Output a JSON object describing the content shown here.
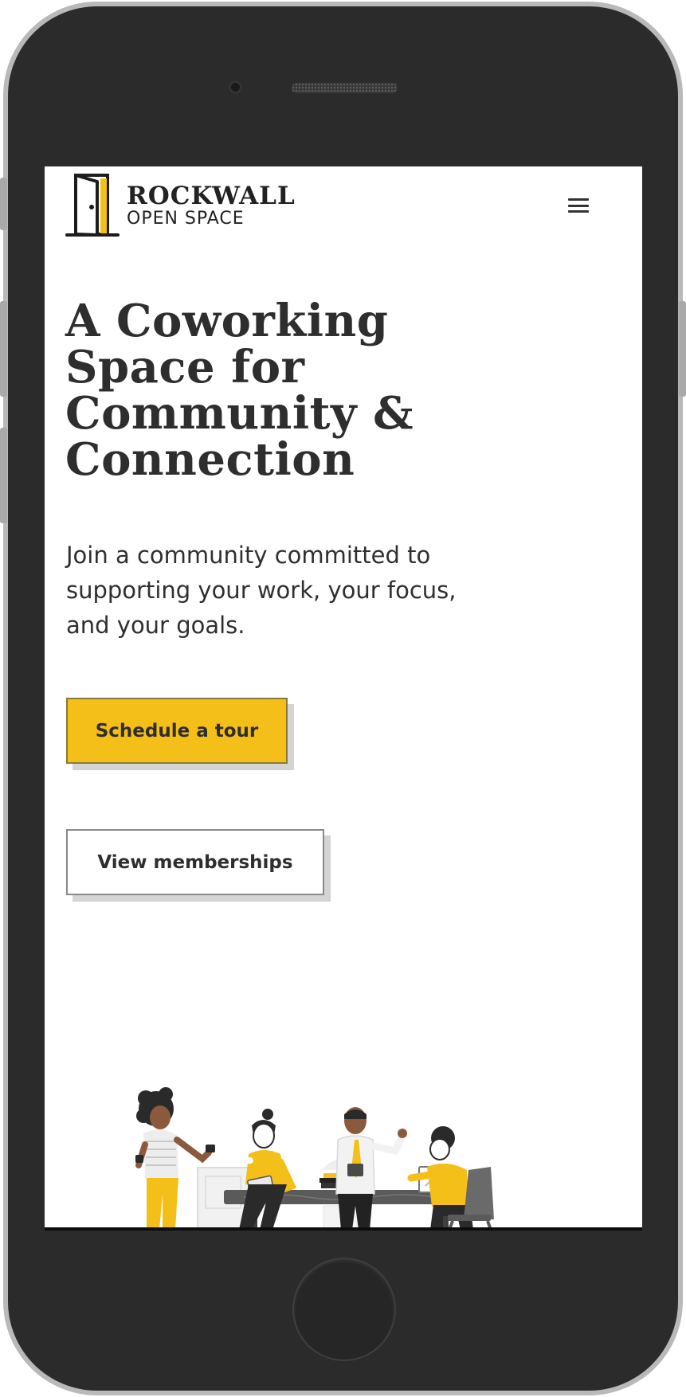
{
  "brand": {
    "name": "ROCKWALL",
    "tagline": "OPEN SPACE"
  },
  "hero": {
    "headline_lines": [
      "A Coworking",
      "Space for",
      "Community &",
      "Connection"
    ],
    "subtext_lines": [
      "Join a community committed to",
      "supporting your work, your focus,",
      "and your goals."
    ]
  },
  "actions": {
    "primary_label": "Schedule a tour",
    "secondary_label": "View memberships"
  },
  "colors": {
    "accent": "#f5bf1a",
    "text": "#2e2e2e",
    "frame": "#2b2b2b"
  },
  "icons": {
    "menu": "hamburger-menu-icon",
    "logo": "door-icon"
  }
}
